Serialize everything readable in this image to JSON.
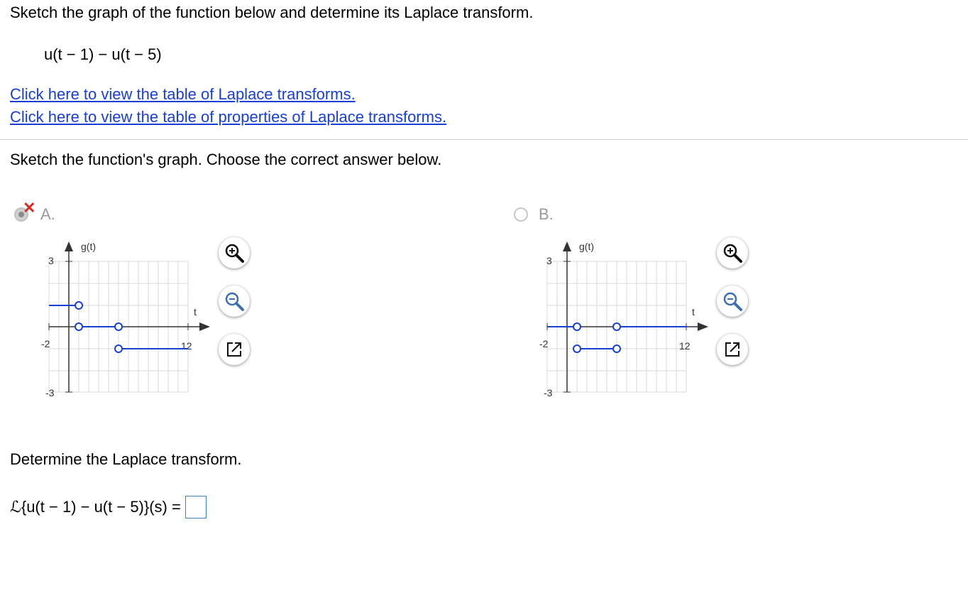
{
  "question": {
    "title": "Sketch the graph of the function below and determine its Laplace transform.",
    "function": "u(t − 1) − u(t − 5)"
  },
  "links": {
    "table": "Click here to view the table of Laplace transforms.",
    "properties": "Click here to view the table of properties of Laplace transforms."
  },
  "part1": {
    "prompt": "Sketch the function's graph. Choose the correct answer below.",
    "options": [
      {
        "letter": "A.",
        "selected": true,
        "marked_incorrect": true
      },
      {
        "letter": "B.",
        "selected": false,
        "marked_incorrect": false
      }
    ]
  },
  "graph": {
    "ylabel": "g(t)",
    "xlabel": "t",
    "y_max_label": "3",
    "y_min_label": "-3",
    "x_min_label": "-2",
    "x_max_label": "12"
  },
  "part2": {
    "prompt": "Determine the Laplace transform.",
    "expression": "ℒ{u(t − 1) − u(t − 5)}(s) ="
  },
  "icons": {
    "zoom_in": "zoom-in-icon",
    "zoom_out": "zoom-out-icon",
    "popout": "popout-icon",
    "incorrect": "x-mark-icon"
  },
  "colors": {
    "link": "#1a3fd6",
    "curve": "#1a3fd6",
    "incorrect": "#e0281f"
  }
}
